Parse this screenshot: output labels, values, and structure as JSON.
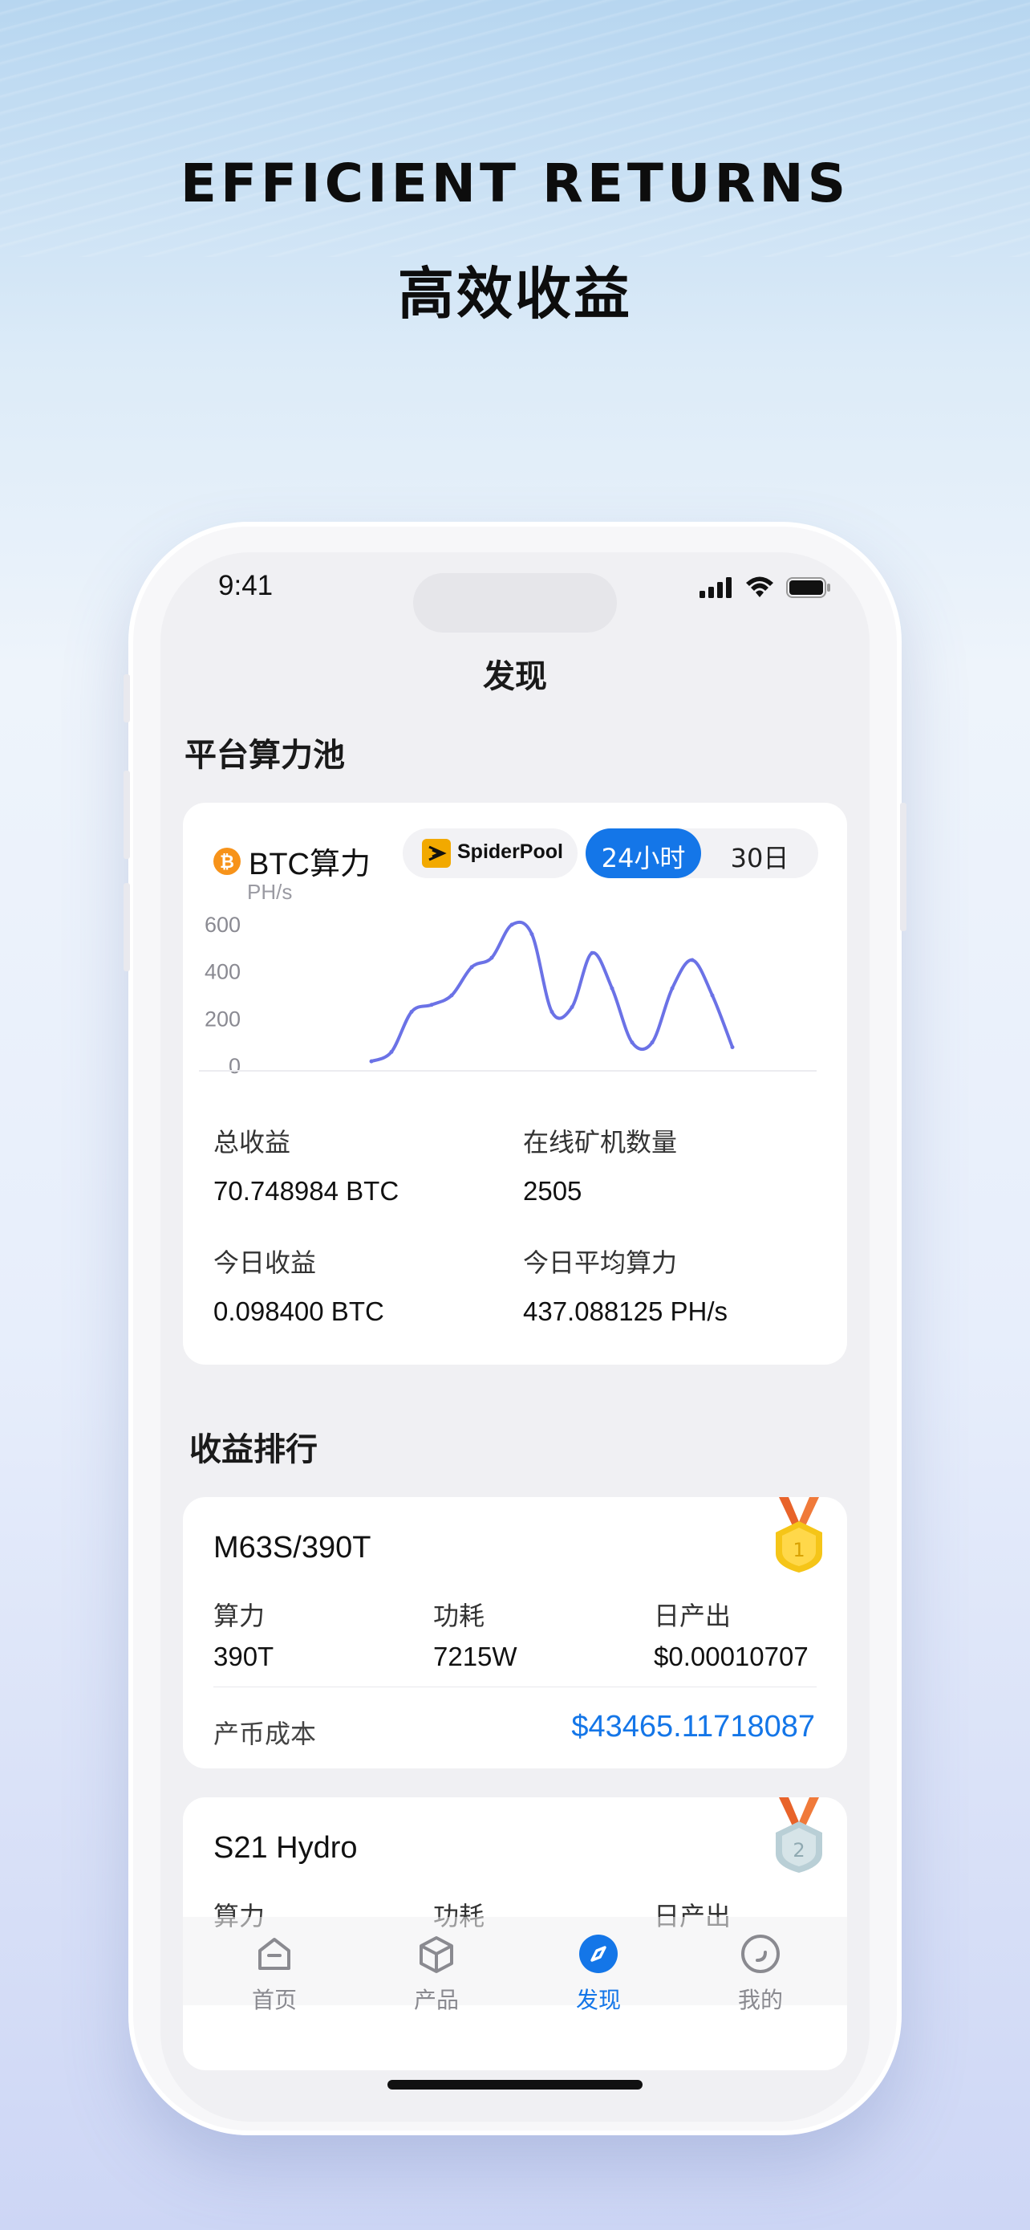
{
  "promo": {
    "headline_en": "EFFICIENT RETURNS",
    "headline_cn": "高效收益"
  },
  "status_bar": {
    "time": "9:41"
  },
  "screen": {
    "title": "发现"
  },
  "hashpool": {
    "section_title": "平台算力池",
    "coin_label": "BTC算力",
    "pool_badge": "SpiderPool",
    "range_tabs": [
      "24小时",
      "30日"
    ],
    "active_range": "24小时",
    "stats": [
      {
        "label": "总收益",
        "value": "70.748984 BTC"
      },
      {
        "label": "在线矿机数量",
        "value": "2505"
      },
      {
        "label": "今日收益",
        "value": "0.098400 BTC"
      },
      {
        "label": "今日平均算力",
        "value": "437.088125 PH/s"
      }
    ]
  },
  "chart_data": {
    "type": "line",
    "ylabel": "PH/s",
    "yticks": [
      "600",
      "400",
      "200",
      "0"
    ],
    "ylim": [
      0,
      600
    ],
    "grid": false,
    "series": [
      {
        "color": "#6b72e6",
        "values": [
          20,
          60,
          230,
          260,
          300,
          420,
          460,
          600,
          560,
          230,
          250,
          480,
          330,
          100,
          100,
          330,
          450,
          300,
          80
        ]
      }
    ]
  },
  "ranking": {
    "section_title": "收益排行",
    "items": [
      {
        "model": "M63S/390T",
        "rank": "1",
        "metrics": [
          {
            "label": "算力",
            "value": "390T"
          },
          {
            "label": "功耗",
            "value": "7215W"
          },
          {
            "label": "日产出",
            "value": "$0.00010707"
          }
        ],
        "cost_label": "产币成本",
        "cost_value": "$43465.11718087"
      },
      {
        "model": "S21 Hydro",
        "rank": "2",
        "metrics": [
          {
            "label": "算力",
            "value": ""
          },
          {
            "label": "功耗",
            "value": ""
          },
          {
            "label": "日产出",
            "value": ""
          }
        ]
      }
    ]
  },
  "tab_bar": {
    "items": [
      {
        "label": "首页",
        "icon": "home-icon"
      },
      {
        "label": "产品",
        "icon": "box-icon"
      },
      {
        "label": "发现",
        "icon": "compass-icon"
      },
      {
        "label": "我的",
        "icon": "profile-icon"
      }
    ],
    "active": "发现"
  },
  "colors": {
    "accent": "#1476e8",
    "chart_line": "#6b72e6",
    "gold": "#f5c518",
    "bitcoin": "#f7931a"
  }
}
